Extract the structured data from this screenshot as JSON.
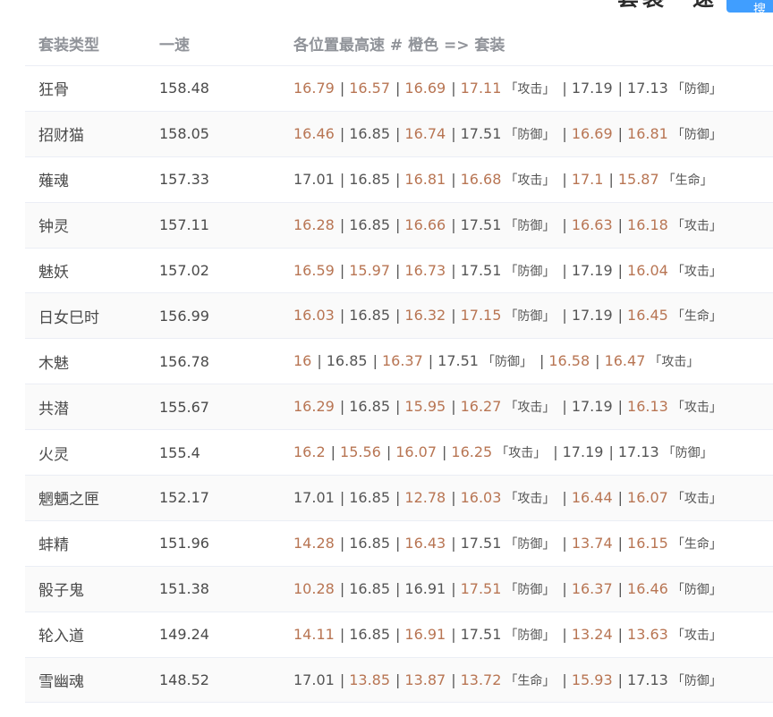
{
  "top": {
    "title": "套装一速",
    "button_label": "搜"
  },
  "table": {
    "headers": {
      "type": "套装类型",
      "speed": "一速",
      "detail": "各位置最高速 # 橙色 => 套装"
    },
    "rows": [
      {
        "name": "狂骨",
        "speed": "158.48",
        "items": [
          {
            "v": "16.79",
            "o": true
          },
          {
            "v": "16.57",
            "o": true
          },
          {
            "v": "16.69",
            "o": true
          },
          {
            "v": "17.11",
            "o": true
          },
          {
            "tag": "「攻击」"
          },
          {
            "v": "17.19",
            "o": false
          },
          {
            "v": "17.13",
            "o": false
          },
          {
            "tag": "「防御」"
          }
        ]
      },
      {
        "name": "招财猫",
        "speed": "158.05",
        "items": [
          {
            "v": "16.46",
            "o": true
          },
          {
            "v": "16.85",
            "o": false
          },
          {
            "v": "16.74",
            "o": true
          },
          {
            "v": "17.51",
            "o": false
          },
          {
            "tag": "「防御」"
          },
          {
            "v": "16.69",
            "o": true
          },
          {
            "v": "16.81",
            "o": true
          },
          {
            "tag": "「防御」"
          }
        ]
      },
      {
        "name": "薙魂",
        "speed": "157.33",
        "items": [
          {
            "v": "17.01",
            "o": false
          },
          {
            "v": "16.85",
            "o": false
          },
          {
            "v": "16.81",
            "o": true
          },
          {
            "v": "16.68",
            "o": true
          },
          {
            "tag": "「攻击」"
          },
          {
            "v": "17.1",
            "o": true
          },
          {
            "v": "15.87",
            "o": true
          },
          {
            "tag": "「生命」"
          }
        ]
      },
      {
        "name": "钟灵",
        "speed": "157.11",
        "items": [
          {
            "v": "16.28",
            "o": true
          },
          {
            "v": "16.85",
            "o": false
          },
          {
            "v": "16.66",
            "o": true
          },
          {
            "v": "17.51",
            "o": false
          },
          {
            "tag": "「防御」"
          },
          {
            "v": "16.63",
            "o": true
          },
          {
            "v": "16.18",
            "o": true
          },
          {
            "tag": "「攻击」"
          }
        ]
      },
      {
        "name": "魅妖",
        "speed": "157.02",
        "items": [
          {
            "v": "16.59",
            "o": true
          },
          {
            "v": "15.97",
            "o": true
          },
          {
            "v": "16.73",
            "o": true
          },
          {
            "v": "17.51",
            "o": false
          },
          {
            "tag": "「防御」"
          },
          {
            "v": "17.19",
            "o": false
          },
          {
            "v": "16.04",
            "o": true
          },
          {
            "tag": "「攻击」"
          }
        ]
      },
      {
        "name": "日女巳时",
        "speed": "156.99",
        "items": [
          {
            "v": "16.03",
            "o": true
          },
          {
            "v": "16.85",
            "o": false
          },
          {
            "v": "16.32",
            "o": true
          },
          {
            "v": "17.15",
            "o": true
          },
          {
            "tag": "「防御」"
          },
          {
            "v": "17.19",
            "o": false
          },
          {
            "v": "16.45",
            "o": true
          },
          {
            "tag": "「生命」"
          }
        ]
      },
      {
        "name": "木魅",
        "speed": "156.78",
        "items": [
          {
            "v": "16",
            "o": true
          },
          {
            "v": "16.85",
            "o": false
          },
          {
            "v": "16.37",
            "o": true
          },
          {
            "v": "17.51",
            "o": false
          },
          {
            "tag": "「防御」"
          },
          {
            "v": "16.58",
            "o": true
          },
          {
            "v": "16.47",
            "o": true
          },
          {
            "tag": "「攻击」"
          }
        ]
      },
      {
        "name": "共潜",
        "speed": "155.67",
        "items": [
          {
            "v": "16.29",
            "o": true
          },
          {
            "v": "16.85",
            "o": false
          },
          {
            "v": "15.95",
            "o": true
          },
          {
            "v": "16.27",
            "o": true
          },
          {
            "tag": "「攻击」"
          },
          {
            "v": "17.19",
            "o": false
          },
          {
            "v": "16.13",
            "o": true
          },
          {
            "tag": "「攻击」"
          }
        ]
      },
      {
        "name": "火灵",
        "speed": "155.4",
        "items": [
          {
            "v": "16.2",
            "o": true
          },
          {
            "v": "15.56",
            "o": true
          },
          {
            "v": "16.07",
            "o": true
          },
          {
            "v": "16.25",
            "o": true
          },
          {
            "tag": "「攻击」"
          },
          {
            "v": "17.19",
            "o": false
          },
          {
            "v": "17.13",
            "o": false
          },
          {
            "tag": "「防御」"
          }
        ]
      },
      {
        "name": "魍魉之匣",
        "speed": "152.17",
        "items": [
          {
            "v": "17.01",
            "o": false
          },
          {
            "v": "16.85",
            "o": false
          },
          {
            "v": "12.78",
            "o": true
          },
          {
            "v": "16.03",
            "o": true
          },
          {
            "tag": "「攻击」"
          },
          {
            "v": "16.44",
            "o": true
          },
          {
            "v": "16.07",
            "o": true
          },
          {
            "tag": "「攻击」"
          }
        ]
      },
      {
        "name": "蚌精",
        "speed": "151.96",
        "items": [
          {
            "v": "14.28",
            "o": true
          },
          {
            "v": "16.85",
            "o": false
          },
          {
            "v": "16.43",
            "o": true
          },
          {
            "v": "17.51",
            "o": false
          },
          {
            "tag": "「防御」"
          },
          {
            "v": "13.74",
            "o": true
          },
          {
            "v": "16.15",
            "o": true
          },
          {
            "tag": "「生命」"
          }
        ]
      },
      {
        "name": "骰子鬼",
        "speed": "151.38",
        "items": [
          {
            "v": "10.28",
            "o": true
          },
          {
            "v": "16.85",
            "o": false
          },
          {
            "v": "16.91",
            "o": false
          },
          {
            "v": "17.51",
            "o": true
          },
          {
            "tag": "「防御」"
          },
          {
            "v": "16.37",
            "o": true
          },
          {
            "v": "16.46",
            "o": true
          },
          {
            "tag": "「防御」"
          }
        ]
      },
      {
        "name": "轮入道",
        "speed": "149.24",
        "items": [
          {
            "v": "14.11",
            "o": true
          },
          {
            "v": "16.85",
            "o": false
          },
          {
            "v": "16.91",
            "o": true
          },
          {
            "v": "17.51",
            "o": false
          },
          {
            "tag": "「防御」"
          },
          {
            "v": "13.24",
            "o": true
          },
          {
            "v": "13.63",
            "o": true
          },
          {
            "tag": "「攻击」"
          }
        ]
      },
      {
        "name": "雪幽魂",
        "speed": "148.52",
        "items": [
          {
            "v": "17.01",
            "o": false
          },
          {
            "v": "13.85",
            "o": true
          },
          {
            "v": "13.87",
            "o": true
          },
          {
            "v": "13.72",
            "o": true
          },
          {
            "tag": "「生命」"
          },
          {
            "v": "15.93",
            "o": true
          },
          {
            "v": "17.13",
            "o": false
          },
          {
            "tag": "「防御」"
          }
        ]
      }
    ]
  },
  "colors": {
    "orange": "#b87553",
    "normal": "#555555",
    "header": "#909399",
    "accent": "#409eff"
  }
}
